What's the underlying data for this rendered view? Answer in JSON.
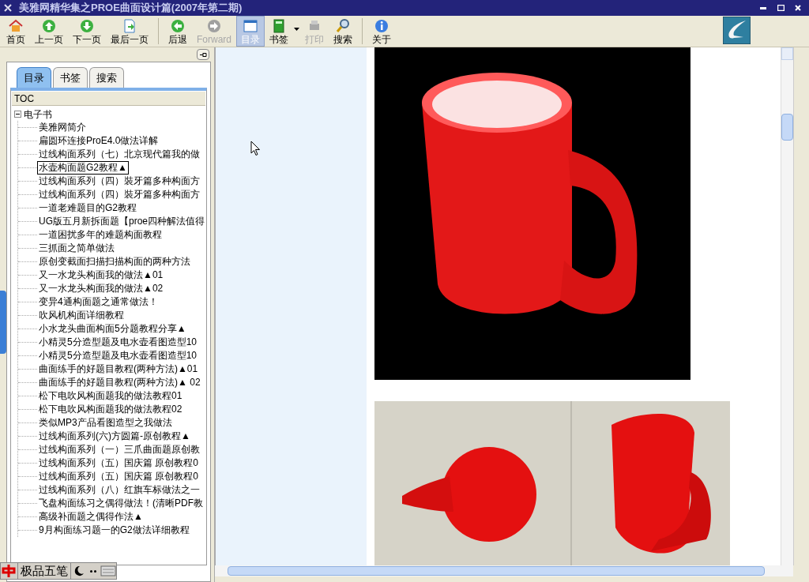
{
  "window": {
    "title": "美雅网精华集之PROE曲面设计篇(2007年第二期)"
  },
  "toolbar": [
    {
      "kind": "button",
      "label": "首页",
      "disabled": false,
      "selected": false
    },
    {
      "kind": "button",
      "label": "上一页",
      "disabled": false,
      "selected": false
    },
    {
      "kind": "button",
      "label": "下一页",
      "disabled": false,
      "selected": false
    },
    {
      "kind": "button",
      "label": "最后一页",
      "disabled": false,
      "selected": false
    },
    {
      "kind": "separator"
    },
    {
      "kind": "button",
      "label": "后退",
      "disabled": false,
      "selected": false
    },
    {
      "kind": "button",
      "label": "Forward",
      "disabled": true,
      "selected": false
    },
    {
      "kind": "button",
      "label": "目录",
      "disabled": false,
      "selected": true
    },
    {
      "kind": "dropdown",
      "label": "书签",
      "disabled": false,
      "selected": false
    },
    {
      "kind": "button",
      "label": "打印",
      "disabled": true,
      "selected": false
    },
    {
      "kind": "button",
      "label": "搜索",
      "disabled": false,
      "selected": false
    },
    {
      "kind": "separator"
    },
    {
      "kind": "button",
      "label": "关于",
      "disabled": false,
      "selected": false
    }
  ],
  "sidebar": {
    "tabs": [
      {
        "label": "目录",
        "selected": true
      },
      {
        "label": "书签",
        "selected": false
      },
      {
        "label": "搜索",
        "selected": false
      }
    ],
    "header": "TOC",
    "tree": {
      "label": "电子书",
      "expanded": true,
      "children": [
        {
          "label": "美雅网简介",
          "selected": false
        },
        {
          "label": "扁圆环连接ProE4.0做法详解",
          "selected": false
        },
        {
          "label": "过线构面系列（七）北京现代篇我的做",
          "selected": false
        },
        {
          "label": "水壶构面题G2教程▲",
          "selected": true
        },
        {
          "label": "过线构面系列（四）裝牙篇多种构面方",
          "selected": false
        },
        {
          "label": "过线构面系列（四）裝牙篇多种构面方",
          "selected": false
        },
        {
          "label": "一道老难题目的G2教程",
          "selected": false
        },
        {
          "label": "UG版五月新拆面题【proe四种解法值得",
          "selected": false
        },
        {
          "label": "一道困扰多年的难题构面教程",
          "selected": false
        },
        {
          "label": "三抓面之简单做法",
          "selected": false
        },
        {
          "label": "原创变截面扫描扫描构面的两种方法",
          "selected": false
        },
        {
          "label": "又一水龙头构面我的做法▲01",
          "selected": false
        },
        {
          "label": "又一水龙头构面我的做法▲02",
          "selected": false
        },
        {
          "label": "变异4通构面题之通常做法！",
          "selected": false
        },
        {
          "label": "吹风机构面详细教程",
          "selected": false
        },
        {
          "label": "小水龙头曲面构面5分题教程分享▲",
          "selected": false
        },
        {
          "label": "小精灵5分造型题及电水壶看图造型10",
          "selected": false
        },
        {
          "label": "小精灵5分造型题及电水壶看图造型10",
          "selected": false
        },
        {
          "label": "曲面练手的好题目教程(两种方法)▲01",
          "selected": false
        },
        {
          "label": "曲面练手的好题目教程(两种方法)▲ 02",
          "selected": false
        },
        {
          "label": "松下电吹风构面题我的做法教程01",
          "selected": false
        },
        {
          "label": "松下电吹风构面题我的做法教程02",
          "selected": false
        },
        {
          "label": "类似MP3产品看图造型之我做法",
          "selected": false
        },
        {
          "label": "过线构面系列(六)方圆篇-原创教程▲",
          "selected": false
        },
        {
          "label": "过线构面系列（一）三爪曲面题原创教",
          "selected": false
        },
        {
          "label": "过线构面系列（五）国庆篇 原创教程0",
          "selected": false
        },
        {
          "label": "过线构面系列（五）国庆篇 原创教程0",
          "selected": false
        },
        {
          "label": "过线构面系列（八）红旗车标做法之一",
          "selected": false
        },
        {
          "label": "飞盘构面练习之偶得做法！(清晰PDF教",
          "selected": false
        },
        {
          "label": "高级补面题之偶得作法▲",
          "selected": false
        },
        {
          "label": "9月构面练习题一的G2做法详细教程",
          "selected": false
        }
      ]
    }
  },
  "ime_bar": {
    "label": "极品五笔"
  }
}
